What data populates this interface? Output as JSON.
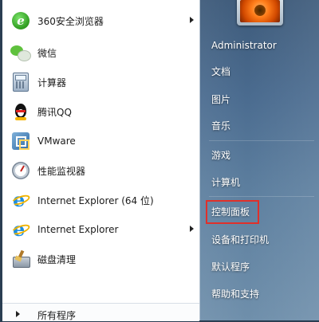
{
  "left_items": [
    {
      "label": "360安全浏览器",
      "icon": "360-browser-icon",
      "has_submenu": true
    },
    {
      "label": "微信",
      "icon": "wechat-icon",
      "has_submenu": false
    },
    {
      "label": "计算器",
      "icon": "calculator-icon",
      "has_submenu": false
    },
    {
      "label": "腾讯QQ",
      "icon": "qq-penguin-icon",
      "has_submenu": false
    },
    {
      "label": "VMware",
      "icon": "vmware-icon",
      "has_submenu": false
    },
    {
      "label": "性能监视器",
      "icon": "performance-monitor-icon",
      "has_submenu": false
    },
    {
      "label": "Internet Explorer (64 位)",
      "icon": "internet-explorer-icon",
      "has_submenu": false
    },
    {
      "label": "Internet Explorer",
      "icon": "internet-explorer-icon",
      "has_submenu": true
    },
    {
      "label": "磁盘清理",
      "icon": "disk-cleanup-icon",
      "has_submenu": false
    }
  ],
  "all_programs": {
    "label": "所有程序"
  },
  "right_items": [
    {
      "label": "Administrator"
    },
    {
      "label": "文档"
    },
    {
      "label": "图片"
    },
    {
      "label": "音乐"
    },
    {
      "label": "游戏"
    },
    {
      "label": "计算机"
    },
    {
      "label": "控制面板",
      "highlighted": true
    },
    {
      "label": "设备和打印机"
    },
    {
      "label": "默认程序"
    },
    {
      "label": "帮助和支持"
    }
  ],
  "colors": {
    "highlight_border": "#e0302a",
    "right_pane": "#4a6b8f",
    "left_pane": "#ffffff"
  }
}
